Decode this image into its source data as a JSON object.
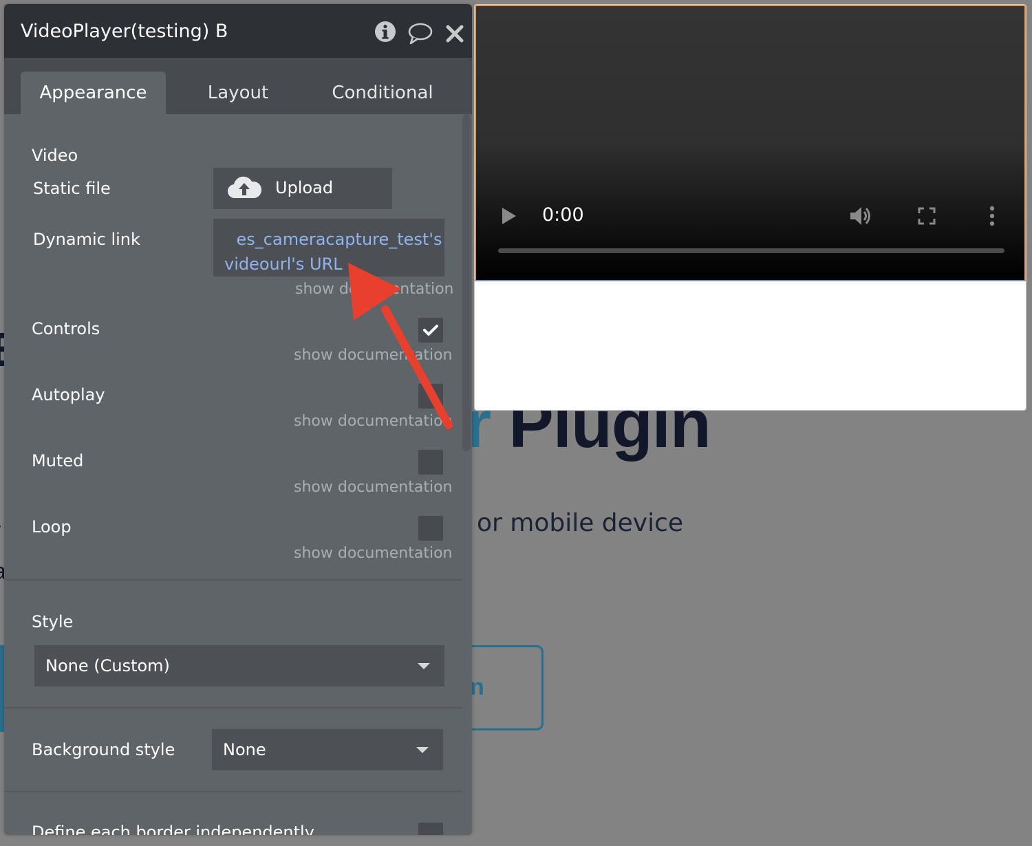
{
  "panel": {
    "title": "VideoPlayer(testing) B",
    "tabs": [
      {
        "label": "Appearance",
        "active": true
      },
      {
        "label": "Layout",
        "active": false
      },
      {
        "label": "Conditional",
        "active": false
      }
    ],
    "section_label": "Video",
    "static_file": {
      "label": "Static file",
      "button_label": "Upload"
    },
    "dynamic_link": {
      "label": "Dynamic link",
      "value_line1": "es_cameracapture_test's",
      "value_line2": "videourl's URL",
      "doc": "show documentation"
    },
    "controls": {
      "label": "Controls",
      "checked": true,
      "doc": "show documentation"
    },
    "autoplay": {
      "label": "Autoplay",
      "checked": false,
      "doc": "show documentation"
    },
    "muted": {
      "label": "Muted",
      "checked": false,
      "doc": "show documentation"
    },
    "loop": {
      "label": "Loop",
      "checked": false,
      "doc": "show documentation"
    },
    "style": {
      "label": "Style",
      "value": "None (Custom)"
    },
    "background_style": {
      "label": "Background style",
      "value": "None"
    },
    "border": {
      "label": "Define each border independently"
    }
  },
  "video_player": {
    "time": "0:00",
    "progress": 0
  },
  "background_page": {
    "headline_accent": "r",
    "headline_rest": " Plugin",
    "subtitle": "or mobile device",
    "button_fragment": "n"
  },
  "colors": {
    "link": "#8fb3ee",
    "annotation_arrow": "#e8402e",
    "brand": "#2a6f8e"
  },
  "icons": {
    "header": [
      "info-icon",
      "comment-icon",
      "close-icon"
    ],
    "player": [
      "play-icon",
      "volume-icon",
      "fullscreen-icon",
      "more-options-icon"
    ],
    "upload": "cloud-upload-icon",
    "checkbox": "checkmark-icon"
  }
}
